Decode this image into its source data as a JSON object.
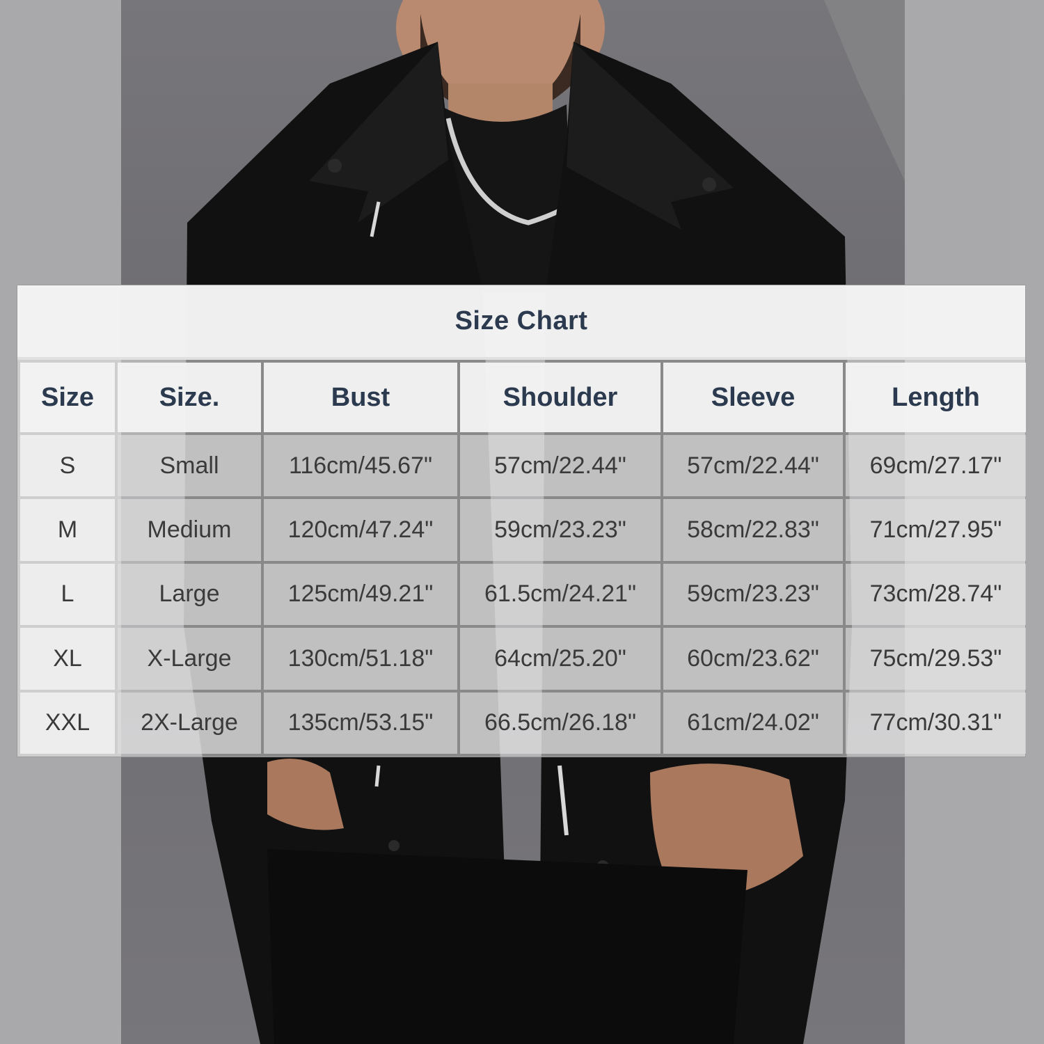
{
  "chart": {
    "title": "Size Chart",
    "headers": [
      "Size",
      "Size.",
      "Bust",
      "Shoulder",
      "Sleeve",
      "Length"
    ],
    "rows": [
      [
        "S",
        "Small",
        "116cm/45.67\"",
        "57cm/22.44\"",
        "57cm/22.44\"",
        "69cm/27.17\""
      ],
      [
        "M",
        "Medium",
        "120cm/47.24\"",
        "59cm/23.23\"",
        "58cm/22.83\"",
        "71cm/27.95\""
      ],
      [
        "L",
        "Large",
        "125cm/49.21\"",
        "61.5cm/24.21\"",
        "59cm/23.23\"",
        "73cm/28.74\""
      ],
      [
        "XL",
        "X-Large",
        "130cm/51.18\"",
        "64cm/25.20\"",
        "60cm/23.62\"",
        "75cm/29.53\""
      ],
      [
        "XXL",
        "2X-Large",
        "135cm/53.15\"",
        "66.5cm/26.18\"",
        "61cm/24.02\"",
        "77cm/30.31\""
      ]
    ]
  },
  "colors": {
    "header_text": "#2b3a4e",
    "cell_text": "#3a3a3a",
    "jacket": "#111111"
  }
}
